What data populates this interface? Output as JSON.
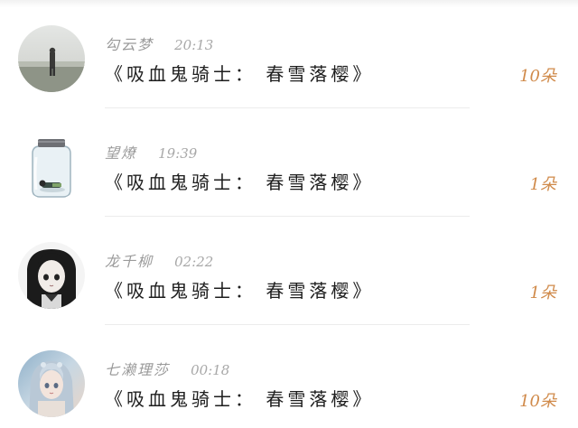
{
  "gifts": [
    {
      "avatar_icon": "avatar-foggy-field-icon",
      "name": "勾云梦",
      "time": "20:13",
      "title": "《吸血鬼骑士： 春雪落樱》",
      "count": "10朵"
    },
    {
      "avatar_icon": "avatar-glass-jar-icon",
      "name": "望燎",
      "time": "19:39",
      "title": "《吸血鬼骑士： 春雪落樱》",
      "count": "1朵"
    },
    {
      "avatar_icon": "avatar-anime-girl-icon",
      "name": "龙千柳",
      "time": "02:22",
      "title": "《吸血鬼骑士： 春雪落樱》",
      "count": "1朵"
    },
    {
      "avatar_icon": "avatar-fantasy-girl-icon",
      "name": "七濑理莎",
      "time": "00:18",
      "title": "《吸血鬼骑士： 春雪落樱》",
      "count": "10朵"
    }
  ],
  "colors": {
    "name": "#9a9a9a",
    "time": "#a8a8a8",
    "title": "#1e1e1e",
    "count": "#d08a4a",
    "divider": "#ececec"
  }
}
